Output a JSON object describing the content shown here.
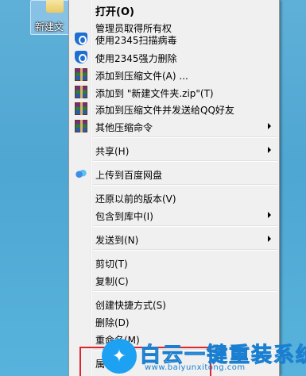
{
  "desktop": {
    "folder_label": "新建文"
  },
  "menu": {
    "items": [
      {
        "label": "打开(O)",
        "icon": "",
        "submenu": false,
        "bold": true
      },
      {
        "label": "管理员取得所有权",
        "icon": "",
        "submenu": false
      },
      {
        "label": "使用2345扫描病毒",
        "icon": "shield-icon",
        "submenu": false
      },
      {
        "label": "使用2345强力删除",
        "icon": "shield-icon",
        "submenu": false
      },
      {
        "label": "添加到压缩文件(A) ...",
        "icon": "winrar-icon",
        "submenu": false
      },
      {
        "label": "添加到 \"新建文件夹.zip\"(T)",
        "icon": "winrar-icon",
        "submenu": false
      },
      {
        "label": "添加到压缩文件并发送给QQ好友",
        "icon": "winrar-icon",
        "submenu": false
      },
      {
        "label": "其他压缩命令",
        "icon": "winrar-icon",
        "submenu": true
      },
      {
        "label": "共享(H)",
        "icon": "",
        "submenu": true
      },
      {
        "label": "上传到百度网盘",
        "icon": "baidu-cloud-icon",
        "submenu": false
      },
      {
        "label": "还原以前的版本(V)",
        "icon": "",
        "submenu": false
      },
      {
        "label": "包含到库中(I)",
        "icon": "",
        "submenu": true
      },
      {
        "label": "发送到(N)",
        "icon": "",
        "submenu": true
      },
      {
        "label": "剪切(T)",
        "icon": "",
        "submenu": false
      },
      {
        "label": "复制(C)",
        "icon": "",
        "submenu": false
      },
      {
        "label": "创建快捷方式(S)",
        "icon": "",
        "submenu": false
      },
      {
        "label": "删除(D)",
        "icon": "",
        "submenu": false
      },
      {
        "label": "重命名(M)",
        "icon": "",
        "submenu": false
      },
      {
        "label": "属",
        "icon": "",
        "submenu": false
      }
    ]
  },
  "watermark": {
    "title": "白云一键重装系统",
    "url": "www.baiyunxitong.com"
  },
  "colors": {
    "menu_bg": "#f0f0f0",
    "highlight": "#e0232c",
    "desktop": "#4ea6d2",
    "watermark": "#1a7fd0"
  }
}
